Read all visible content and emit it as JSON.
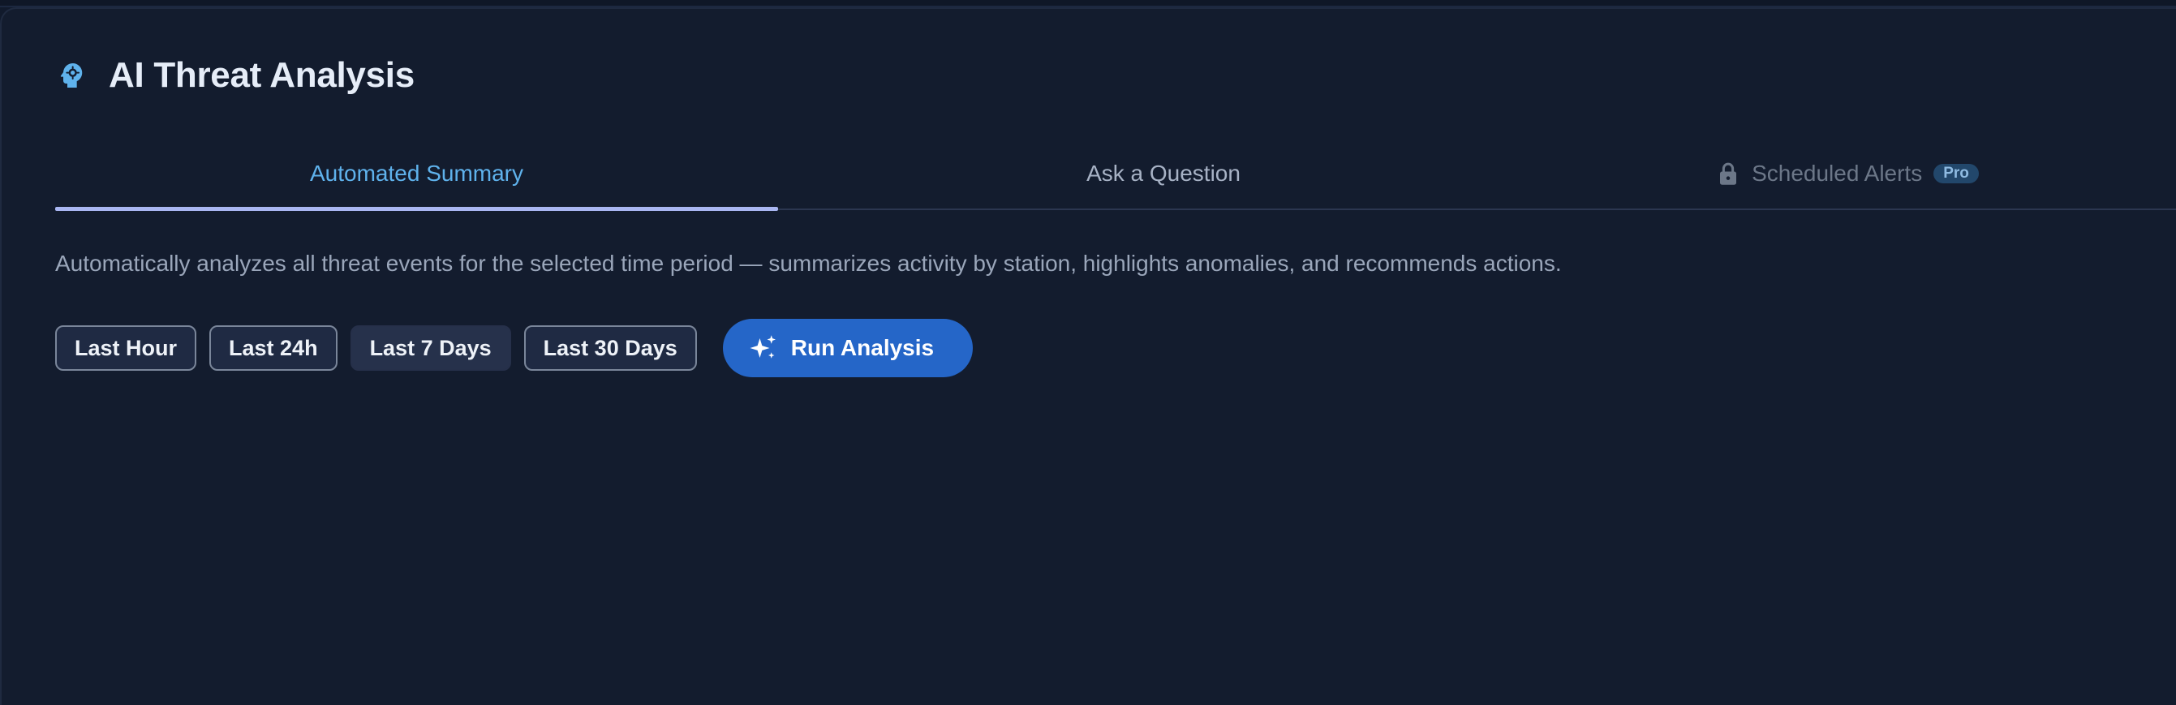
{
  "header": {
    "icon": "ai-brain-gear-icon",
    "title": "AI Threat Analysis"
  },
  "tabs": [
    {
      "label": "Automated Summary",
      "active": true
    },
    {
      "label": "Ask a Question",
      "active": false
    },
    {
      "label": "Scheduled Alerts",
      "active": false,
      "locked": true,
      "icon": "lock-icon",
      "badge": "Pro"
    }
  ],
  "description": "Automatically analyzes all threat events for the selected time period — summarizes activity by station, highlights anomalies, and recommends actions.",
  "time_ranges": [
    {
      "label": "Last Hour",
      "selected": false
    },
    {
      "label": "Last 24h",
      "selected": false
    },
    {
      "label": "Last 7 Days",
      "selected": true
    },
    {
      "label": "Last 30 Days",
      "selected": false
    }
  ],
  "run_button": {
    "label": "Run Analysis",
    "icon": "sparkle-icon"
  },
  "colors": {
    "background": "#131c2e",
    "accent": "#5fb2ec",
    "primary_button": "#2566c8",
    "pro_badge": "#22476b"
  }
}
